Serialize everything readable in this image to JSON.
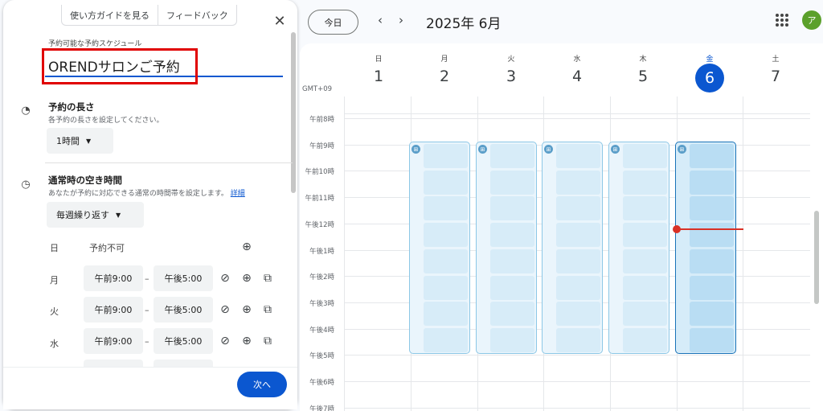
{
  "panel": {
    "tabs": [
      "使い方ガイドを見る",
      "フィードバック"
    ],
    "schedule_label": "予約可能な予約スケジュール",
    "title": "ORENDサロンご予約",
    "duration": {
      "title": "予約の長さ",
      "subtitle": "各予約の長さを設定してください。",
      "value": "1時間"
    },
    "availability": {
      "title": "通常時の空き時間",
      "subtitle": "あなたが予約に対応できる通常の時間帯を設定します。",
      "link": "詳細",
      "repeat": "毎週繰り返す",
      "days": [
        {
          "day": "日",
          "status": "予約不可"
        },
        {
          "day": "月",
          "start": "午前9:00",
          "end": "午後5:00"
        },
        {
          "day": "火",
          "start": "午前9:00",
          "end": "午後5:00"
        },
        {
          "day": "水",
          "start": "午前9:00",
          "end": "午後5:00"
        }
      ],
      "dash": "–"
    },
    "next_button": "次へ"
  },
  "calendar": {
    "today_button": "今日",
    "month": "2025年 6月",
    "avatar": "ア",
    "timezone": "GMT+09",
    "days": [
      {
        "dow": "日",
        "date": "1"
      },
      {
        "dow": "月",
        "date": "2"
      },
      {
        "dow": "火",
        "date": "3"
      },
      {
        "dow": "水",
        "date": "4"
      },
      {
        "dow": "木",
        "date": "5"
      },
      {
        "dow": "金",
        "date": "6",
        "today": true
      },
      {
        "dow": "土",
        "date": "7"
      }
    ],
    "hours": [
      "午前8時",
      "午前9時",
      "午前10時",
      "午前11時",
      "午後12時",
      "午後1時",
      "午後2時",
      "午後3時",
      "午後4時",
      "午後5時",
      "午後6時",
      "午後7時"
    ],
    "icons": {
      "close": "close-icon",
      "prev": "chevron-left-icon",
      "next": "chevron-right-icon",
      "apps": "apps-grid-icon"
    },
    "colors": {
      "accent": "#0b57d0",
      "block": "#8cc7e6",
      "now": "#d93025"
    }
  }
}
